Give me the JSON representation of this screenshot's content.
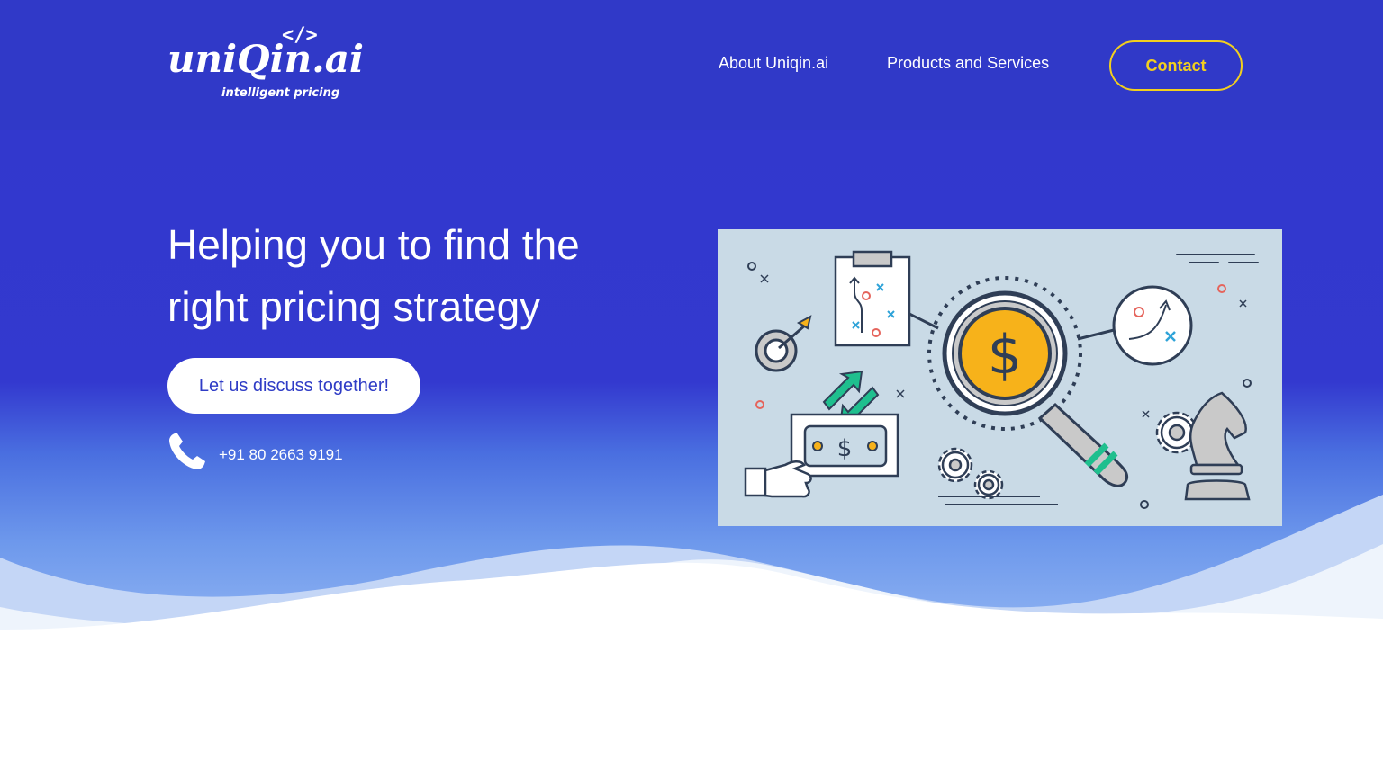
{
  "brand": {
    "logo_text": "uniQin.ai",
    "logo_code_glyph": "</>",
    "tagline": "intelligent pricing"
  },
  "nav": {
    "items": [
      {
        "label": "About Uniqin.ai"
      },
      {
        "label": "Products and Services"
      }
    ],
    "contact_label": "Contact"
  },
  "hero": {
    "headline_line1": "Helping you to find the",
    "headline_line2": "right pricing strategy",
    "cta_label": "Let us discuss together!",
    "phone": "+91 80 2663 9191"
  },
  "illustration": {
    "dollar_symbol": "$"
  },
  "colors": {
    "header_bg": "#3039c8",
    "hero_bg": "#3339cf",
    "accent_yellow": "#f2cf1e",
    "cta_text": "#2f3cc6",
    "illustration_bg": "#c9dae6",
    "coin": "#f7b21a",
    "arrow_green": "#1fbf8e"
  },
  "icons": [
    "phone-icon",
    "magnifier-icon",
    "dollar-coin-icon",
    "target-icon",
    "clipboard-icon",
    "chess-knight-icon",
    "gear-icon",
    "money-bill-icon",
    "hand-icon",
    "chart-circle-icon"
  ]
}
